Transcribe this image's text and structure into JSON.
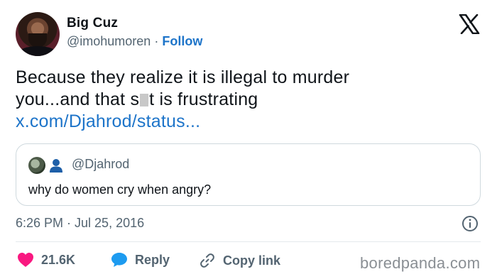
{
  "user": {
    "name": "Big Cuz",
    "handle": "@imohumoren",
    "separator": "·",
    "follow_label": "Follow"
  },
  "tweet": {
    "line1": "Because they realize it is illegal to murder",
    "line2_a": "you...and that s",
    "line2_b": "t is frustrating",
    "link": "x.com/Djahrod/status..."
  },
  "quote": {
    "handle": "@Djahrod",
    "text": "why do women cry when angry?"
  },
  "timestamp": "6:26 PM · Jul 25, 2016",
  "actions": {
    "likes": "21.6K",
    "reply_label": "Reply",
    "copy_label": "Copy link"
  },
  "watermark": "boredpanda.com",
  "colors": {
    "like_red": "#f91880",
    "reply_blue": "#1d9bf0",
    "link_blue": "#1d74c9",
    "muted": "#536471"
  },
  "icons": [
    "x-logo-icon",
    "person-icon",
    "info-icon",
    "heart-icon",
    "reply-bubble-icon",
    "link-icon"
  ]
}
